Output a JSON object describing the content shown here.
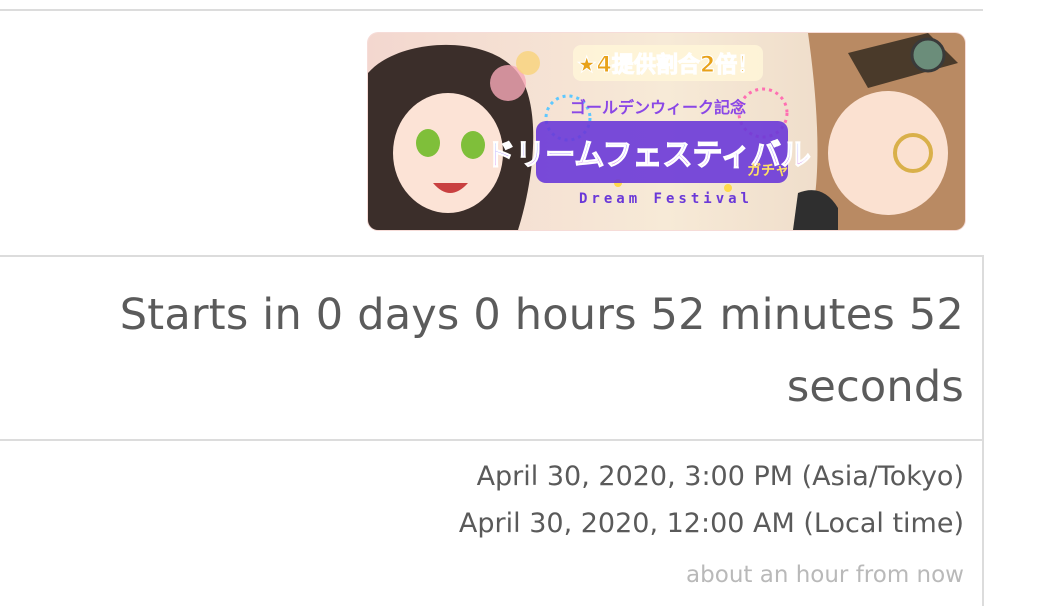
{
  "banner": {
    "badge_text": "★4提供割合2倍！",
    "subtitle_jp": "ゴールデンウィーク記念",
    "title_jp": "ドリームフェスティバル",
    "gacha_jp": "ガチャ",
    "title_en": "Dream Festival",
    "colors": {
      "title_fill": "#7a4df0",
      "badge_fill": "#e8a21a",
      "background": "#fbe9e6"
    }
  },
  "countdown": {
    "text": "Starts in 0 days 0 hours 52 minutes 52 seconds"
  },
  "dates": {
    "tokyo": "April 30, 2020, 3:00 PM (Asia/Tokyo)",
    "local": "April 30, 2020, 12:00 AM (Local time)",
    "relative": "about an hour from now"
  }
}
